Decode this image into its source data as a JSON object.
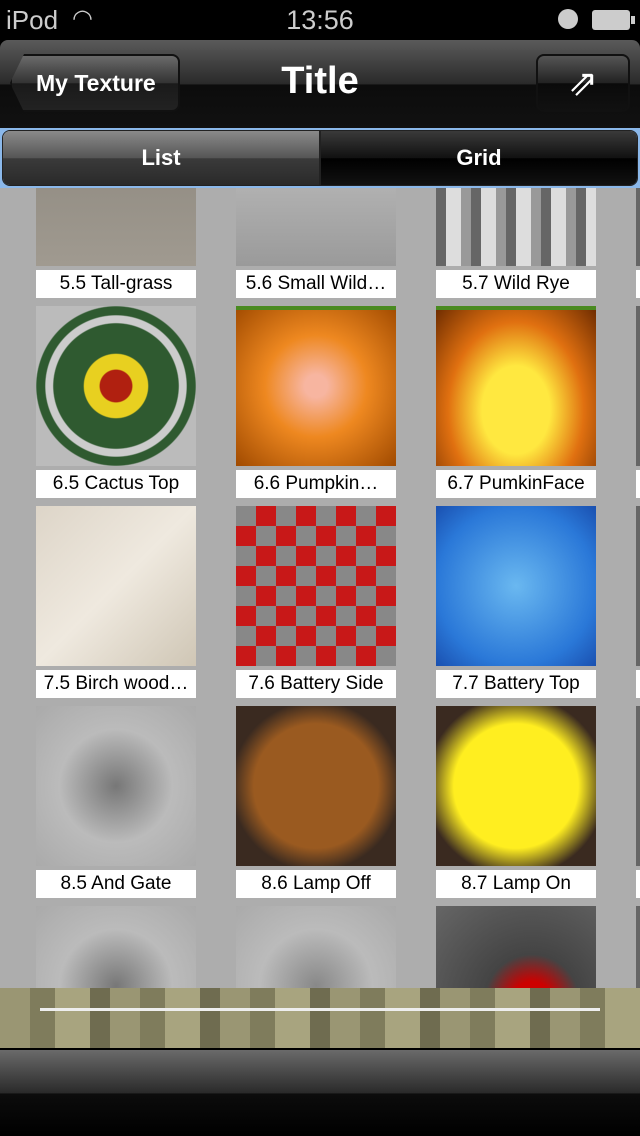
{
  "status": {
    "carrier": "iPod",
    "time": "13:56"
  },
  "nav": {
    "back_label": "My Texture",
    "title": "Title",
    "share_icon": "share-icon"
  },
  "segments": {
    "list": "List",
    "grid": "Grid",
    "selected": "Grid"
  },
  "tiles": [
    {
      "label": "5.5  Tall-grass",
      "bg": "linear-gradient(#8a857c,#a09a90)"
    },
    {
      "label": "5.6  Small Wild…",
      "bg": "linear-gradient(#c8c8c8,#9a9a9a)"
    },
    {
      "label": "5.7  Wild Rye",
      "bg": "repeating-linear-gradient(90deg,#666 0 10px,#ddd 10px 25px,#999 25px 35px)"
    },
    {
      "label": "6.5  Cactus Top",
      "bg": "radial-gradient(circle,#b02010 0 14%,#e8d020 15% 28%,#2f5a30 29% 55%,#ccc 56% 62%,#2f5a30 63% 70%,#bbb 71%)"
    },
    {
      "label": "6.6  Pumpkin…",
      "bg": "linear-gradient(#4a8a20 0 4px,transparent 4px),radial-gradient(circle,#f7b5a0 0 10%,#ee8820 45%,#a04a00 100%)"
    },
    {
      "label": "6.7  PumkinFace",
      "bg": "linear-gradient(#4a8a20 0 4px,transparent 4px),radial-gradient(ellipse at 50% 65%,#ffe840 0 30%,#e07010 60%,#6a2a00 100%)"
    },
    {
      "label": "7.5  Birch wood…",
      "bg": "linear-gradient(135deg,#ddd5c8,#efe9df 50%,#cfc6b5)"
    },
    {
      "label": "7.6  Battery Side",
      "bg": "repeating-conic-gradient(#c81818 0 25%,#888 0 50%) 0 0/40px 40px"
    },
    {
      "label": "7.7  Battery Top",
      "bg": "radial-gradient(circle,#6ab8f0,#2a78d8 70%,#1a50b0)"
    },
    {
      "label": "8.5  And Gate",
      "bg": "radial-gradient(circle,#777,#bbb 50%,#aaa)"
    },
    {
      "label": "8.6  Lamp Off",
      "bg": "radial-gradient(circle,#9a5a20 0 55%,#3a2a20 75%)"
    },
    {
      "label": "8.7  Lamp On",
      "bg": "radial-gradient(circle,#ffee20 0 55%,#3a2a20 80%)"
    },
    {
      "label": "",
      "bg": "radial-gradient(circle,#777,#bbb 50%,#aaa)"
    },
    {
      "label": "",
      "bg": "radial-gradient(circle,#888,#bbb 50%,#aaa)"
    },
    {
      "label": "",
      "bg": "radial-gradient(circle at 60% 60%,#c00 0 15%,#444 35%,#666)"
    }
  ]
}
